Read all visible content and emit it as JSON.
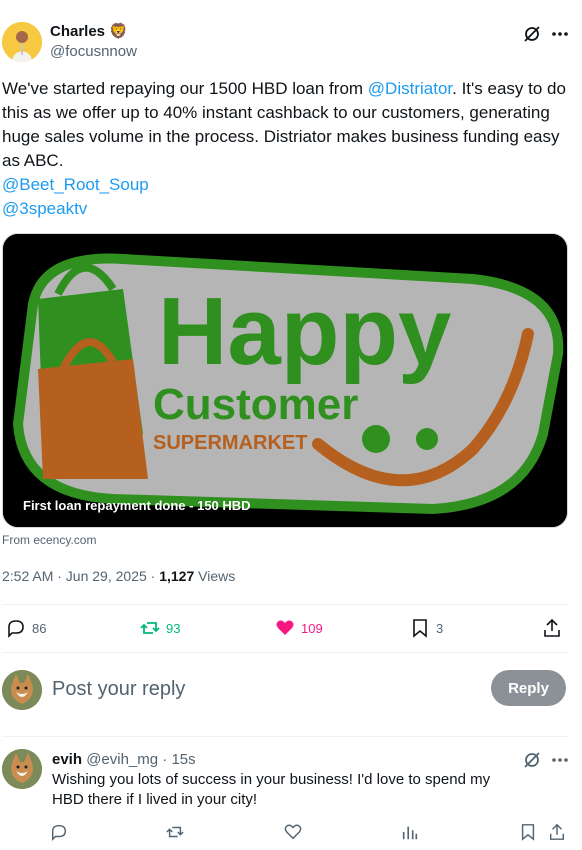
{
  "post": {
    "author_name": "Charles",
    "author_emoji": "🦁",
    "handle": "@focusnnow",
    "text_before": "We've started repaying our 1500 HBD loan from ",
    "mention_1": "@Distriator",
    "text_after": ". It's easy to do this as we offer up to 40% instant cashback to our customers, generating huge sales volume in the process. Distriator makes business funding easy as ABC.",
    "mention_2": "@Beet_Root_Soup",
    "mention_3": "@3speaktv",
    "media": {
      "logo_word_1": "Happy",
      "logo_word_2": "Customer",
      "logo_word_3": "SUPERMARKET",
      "caption": "First loan repayment done - 150 HBD"
    },
    "source": "From ecency.com",
    "timestamp": "2:52 AM · Jun 29, 2025 · ",
    "views_count": "1,127",
    "views_label": " Views",
    "stats": {
      "replies": "86",
      "reposts": "93",
      "likes": "109",
      "bookmarks": "3"
    },
    "colors": {
      "repost": "#00ba7c",
      "like": "#f91880",
      "link": "#1d9bf0"
    }
  },
  "composer": {
    "placeholder": "Post your reply",
    "button_label": "Reply"
  },
  "reply": {
    "name": "evih",
    "handle_time": "@evih_mg · 15s",
    "text": "Wishing you lots of success in your business! I'd love to spend my HBD there if I lived in your city!"
  }
}
